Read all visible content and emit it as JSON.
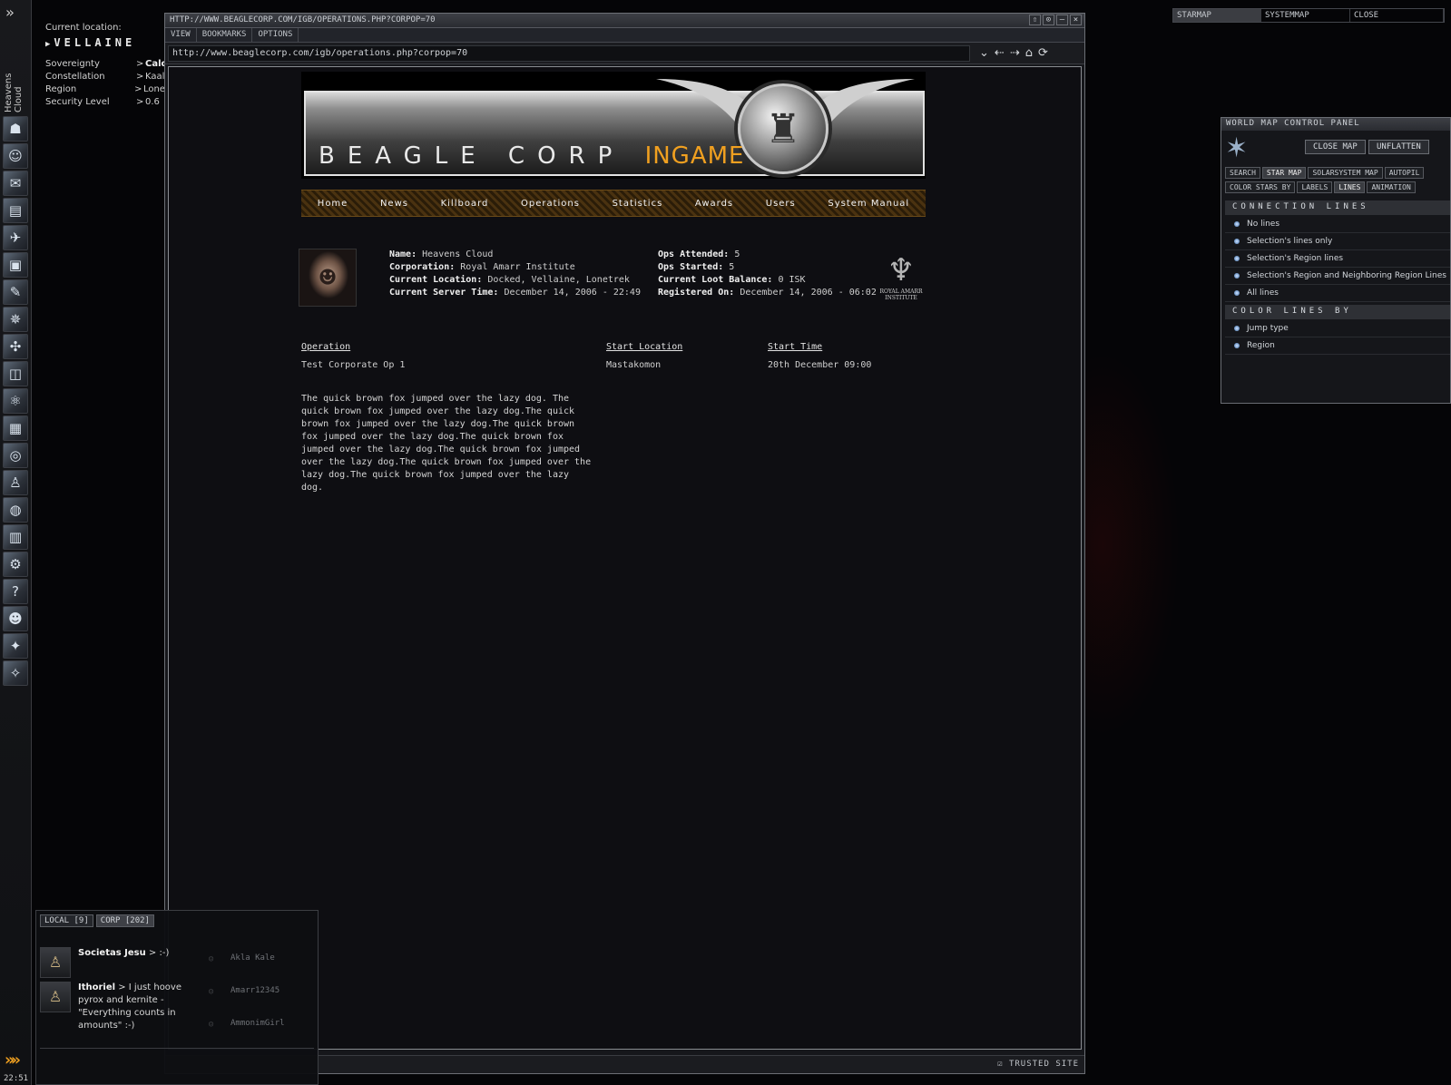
{
  "neocom": {
    "expand_glyph": "»",
    "pilot_name": "Heavens Cloud",
    "icons": [
      {
        "name": "character-sheet-icon",
        "glyph": "☗"
      },
      {
        "name": "people-icon",
        "glyph": "☺"
      },
      {
        "name": "mail-icon",
        "glyph": "✉"
      },
      {
        "name": "notepad-icon",
        "glyph": "▤"
      },
      {
        "name": "ship-icon",
        "glyph": "✈"
      },
      {
        "name": "assets-icon",
        "glyph": "▣"
      },
      {
        "name": "journal-icon",
        "glyph": "✎"
      },
      {
        "name": "map-icon",
        "glyph": "✵"
      },
      {
        "name": "corporation-icon",
        "glyph": "✣"
      },
      {
        "name": "market-icon",
        "glyph": "◫"
      },
      {
        "name": "science-icon",
        "glyph": "⚛"
      },
      {
        "name": "calculator-icon",
        "glyph": "▦"
      },
      {
        "name": "help-icon",
        "glyph": "◎"
      },
      {
        "name": "people-and-places-icon",
        "glyph": "♙"
      },
      {
        "name": "browser-icon",
        "glyph": "◍"
      },
      {
        "name": "logbook-icon",
        "glyph": "▥"
      },
      {
        "name": "fitting-icon",
        "glyph": "⚙"
      },
      {
        "name": "info-icon",
        "glyph": "?"
      },
      {
        "name": "portrait-icon",
        "glyph": "☻"
      },
      {
        "name": "drones-icon",
        "glyph": "✦"
      },
      {
        "name": "settings-icon",
        "glyph": "✧"
      }
    ],
    "bottom_arrow": "»»",
    "clock": "22:51"
  },
  "location": {
    "title": "Current location:",
    "system": "VELLAINE",
    "rows": [
      {
        "label": "Sovereignty",
        "value": "Cald"
      },
      {
        "label": "Constellation",
        "value": "Kaala"
      },
      {
        "label": "Region",
        "value": "Lonetr"
      },
      {
        "label": "Security Level",
        "value": "0.6"
      }
    ]
  },
  "browser": {
    "title": "HTTP://WWW.BEAGLECORP.COM/IGB/OPERATIONS.PHP?CORPOP=70",
    "menu": [
      "VIEW",
      "BOOKMARKS",
      "OPTIONS"
    ],
    "url": "http://www.beaglecorp.com/igb/operations.php?corpop=70",
    "status": "TRUSTED SITE"
  },
  "page": {
    "banner": {
      "text_main": "BEAGLE CORP",
      "text_accent": "INGAME"
    },
    "nav": [
      "Home",
      "News",
      "Killboard",
      "Operations",
      "Statistics",
      "Awards",
      "Users",
      "System Manual"
    ],
    "profile": {
      "name_label": "Name:",
      "name": "Heavens Cloud",
      "corp_label": "Corporation:",
      "corp": "Royal Amarr Institute",
      "location_label": "Current Location:",
      "location": "Docked, Vellaine, Lonetrek",
      "time_label": "Current Server Time:",
      "time": "December 14, 2006 - 22:49",
      "ops_attended_label": "Ops Attended:",
      "ops_attended": "5",
      "ops_started_label": "Ops Started:",
      "ops_started": "5",
      "loot_label": "Current Loot Balance:",
      "loot": "0 ISK",
      "registered_label": "Registered On:",
      "registered": "December 14, 2006 - 06:02",
      "corp_logo_text": "ROYAL AMARR INSTITUTE"
    },
    "ops_table": {
      "headers": [
        "Operation",
        "Start Location",
        "Start Time"
      ],
      "rows": [
        [
          "Test Corporate Op 1",
          "Mastakomon",
          "20th December 09:00"
        ]
      ]
    },
    "description": "The quick brown fox jumped over the lazy dog. The quick brown fox jumped over the lazy dog.The quick brown fox jumped over the lazy dog.The quick brown fox jumped over the lazy dog.The quick brown fox jumped over the lazy dog.The quick brown fox jumped over the lazy dog.The quick brown fox jumped over the lazy dog.The quick brown fox jumped over the lazy dog."
  },
  "map_tabs": [
    "STARMAP",
    "SYSTEMMAP",
    "CLOSE"
  ],
  "map_panel": {
    "title": "WORLD MAP CONTROL PANEL",
    "close_map": "CLOSE MAP",
    "unflatten": "UNFLATTEN",
    "tabs1": [
      "SEARCH",
      "STAR MAP",
      "SOLARSYSTEM MAP",
      "AUTOPIL"
    ],
    "tabs2": [
      "COLOR STARS BY",
      "LABELS",
      "LINES",
      "ANIMATION"
    ],
    "section1": "CONNECTION LINES",
    "options1": [
      "No lines",
      "Selection's lines only",
      "Selection's Region lines",
      "Selection's Region and Neighboring Region Lines",
      "All lines"
    ],
    "section2": "COLOR LINES BY",
    "options2": [
      "Jump type",
      "Region"
    ]
  },
  "chat": {
    "tabs": [
      "LOCAL [9]",
      "CORP [202]"
    ],
    "messages": [
      {
        "sender": "Societas Jesu",
        "text": " > :-)"
      },
      {
        "sender": "Ithoriel",
        "text": " > I just hoove pyrox and kernite - \"Everything counts in amounts\" :-)"
      }
    ],
    "members": [
      "Akla Kale",
      "Amarr12345",
      "AmmonimGirl"
    ]
  }
}
